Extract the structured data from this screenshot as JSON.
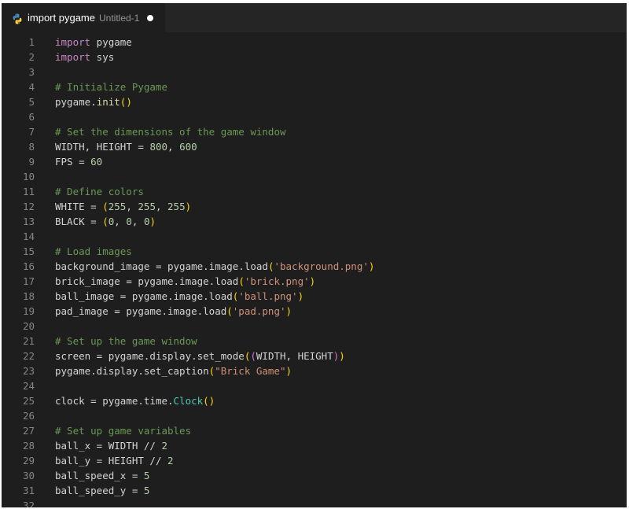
{
  "tab": {
    "title": "import pygame",
    "description": "Untitled-1",
    "icon": "python-file-icon",
    "dirty": true
  },
  "lines": [
    {
      "n": "1",
      "tokens": [
        [
          "import",
          "kw"
        ],
        [
          " pygame",
          "plain"
        ]
      ]
    },
    {
      "n": "2",
      "tokens": [
        [
          "import",
          "kw"
        ],
        [
          " sys",
          "plain"
        ]
      ]
    },
    {
      "n": "3",
      "tokens": []
    },
    {
      "n": "4",
      "tokens": [
        [
          "# Initialize Pygame",
          "cm"
        ]
      ]
    },
    {
      "n": "5",
      "tokens": [
        [
          "pygame",
          "plain"
        ],
        [
          ".",
          "plain"
        ],
        [
          "init",
          "fn"
        ],
        [
          "()",
          "p1"
        ]
      ]
    },
    {
      "n": "6",
      "tokens": []
    },
    {
      "n": "7",
      "tokens": [
        [
          "# Set the dimensions of the game window",
          "cm"
        ]
      ]
    },
    {
      "n": "8",
      "tokens": [
        [
          "WIDTH",
          "plain"
        ],
        [
          ", ",
          "plain"
        ],
        [
          "HEIGHT",
          "plain"
        ],
        [
          " = ",
          "plain"
        ],
        [
          "800",
          "num"
        ],
        [
          ", ",
          "plain"
        ],
        [
          "600",
          "num"
        ]
      ]
    },
    {
      "n": "9",
      "tokens": [
        [
          "FPS",
          "plain"
        ],
        [
          " = ",
          "plain"
        ],
        [
          "60",
          "num"
        ]
      ]
    },
    {
      "n": "10",
      "tokens": []
    },
    {
      "n": "11",
      "tokens": [
        [
          "# Define colors",
          "cm"
        ]
      ]
    },
    {
      "n": "12",
      "tokens": [
        [
          "WHITE",
          "plain"
        ],
        [
          " = ",
          "plain"
        ],
        [
          "(",
          "p1"
        ],
        [
          "255",
          "num"
        ],
        [
          ", ",
          "plain"
        ],
        [
          "255",
          "num"
        ],
        [
          ", ",
          "plain"
        ],
        [
          "255",
          "num"
        ],
        [
          ")",
          "p1"
        ]
      ]
    },
    {
      "n": "13",
      "tokens": [
        [
          "BLACK",
          "plain"
        ],
        [
          " = ",
          "plain"
        ],
        [
          "(",
          "p1"
        ],
        [
          "0",
          "num"
        ],
        [
          ", ",
          "plain"
        ],
        [
          "0",
          "num"
        ],
        [
          ", ",
          "plain"
        ],
        [
          "0",
          "num"
        ],
        [
          ")",
          "p1"
        ]
      ]
    },
    {
      "n": "14",
      "tokens": []
    },
    {
      "n": "15",
      "tokens": [
        [
          "# Load images",
          "cm"
        ]
      ]
    },
    {
      "n": "16",
      "tokens": [
        [
          "background_image",
          "plain"
        ],
        [
          " = ",
          "plain"
        ],
        [
          "pygame.image.load",
          "plain"
        ],
        [
          "(",
          "p1"
        ],
        [
          "'background.png'",
          "str"
        ],
        [
          ")",
          "p1"
        ]
      ]
    },
    {
      "n": "17",
      "tokens": [
        [
          "brick_image",
          "plain"
        ],
        [
          " = ",
          "plain"
        ],
        [
          "pygame.image.load",
          "plain"
        ],
        [
          "(",
          "p1"
        ],
        [
          "'brick.png'",
          "str"
        ],
        [
          ")",
          "p1"
        ]
      ]
    },
    {
      "n": "18",
      "tokens": [
        [
          "ball_image",
          "plain"
        ],
        [
          " = ",
          "plain"
        ],
        [
          "pygame.image.load",
          "plain"
        ],
        [
          "(",
          "p1"
        ],
        [
          "'ball.png'",
          "str"
        ],
        [
          ")",
          "p1"
        ]
      ]
    },
    {
      "n": "19",
      "tokens": [
        [
          "pad_image",
          "plain"
        ],
        [
          " = ",
          "plain"
        ],
        [
          "pygame.image.load",
          "plain"
        ],
        [
          "(",
          "p1"
        ],
        [
          "'pad.png'",
          "str"
        ],
        [
          ")",
          "p1"
        ]
      ]
    },
    {
      "n": "20",
      "tokens": []
    },
    {
      "n": "21",
      "tokens": [
        [
          "# Set up the game window",
          "cm"
        ]
      ]
    },
    {
      "n": "22",
      "tokens": [
        [
          "screen",
          "plain"
        ],
        [
          " = ",
          "plain"
        ],
        [
          "pygame.display.set_mode",
          "plain"
        ],
        [
          "(",
          "p1"
        ],
        [
          "(",
          "p2"
        ],
        [
          "WIDTH, HEIGHT",
          "plain"
        ],
        [
          ")",
          "p2"
        ],
        [
          ")",
          "p1"
        ]
      ]
    },
    {
      "n": "23",
      "tokens": [
        [
          "pygame.display.set_caption",
          "plain"
        ],
        [
          "(",
          "p1"
        ],
        [
          "\"Brick Game\"",
          "str"
        ],
        [
          ")",
          "p1"
        ]
      ]
    },
    {
      "n": "24",
      "tokens": []
    },
    {
      "n": "25",
      "tokens": [
        [
          "clock",
          "plain"
        ],
        [
          " = ",
          "plain"
        ],
        [
          "pygame.time.",
          "plain"
        ],
        [
          "Clock",
          "cls"
        ],
        [
          "()",
          "p1"
        ]
      ]
    },
    {
      "n": "26",
      "tokens": []
    },
    {
      "n": "27",
      "tokens": [
        [
          "# Set up game variables",
          "cm"
        ]
      ]
    },
    {
      "n": "28",
      "tokens": [
        [
          "ball_x",
          "plain"
        ],
        [
          " = ",
          "plain"
        ],
        [
          "WIDTH // ",
          "plain"
        ],
        [
          "2",
          "num"
        ]
      ]
    },
    {
      "n": "29",
      "tokens": [
        [
          "ball_y",
          "plain"
        ],
        [
          " = ",
          "plain"
        ],
        [
          "HEIGHT // ",
          "plain"
        ],
        [
          "2",
          "num"
        ]
      ]
    },
    {
      "n": "30",
      "tokens": [
        [
          "ball_speed_x",
          "plain"
        ],
        [
          " = ",
          "plain"
        ],
        [
          "5",
          "num"
        ]
      ]
    },
    {
      "n": "31",
      "tokens": [
        [
          "ball_speed_y",
          "plain"
        ],
        [
          " = ",
          "plain"
        ],
        [
          "5",
          "num"
        ]
      ]
    },
    {
      "n": "32",
      "tokens": []
    }
  ]
}
